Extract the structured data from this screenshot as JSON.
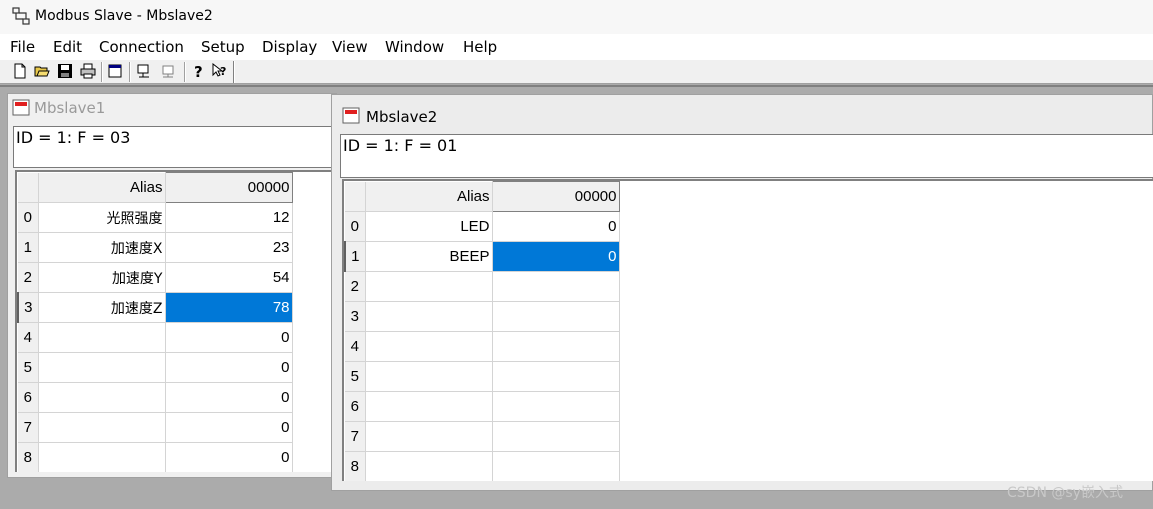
{
  "app": {
    "title": "Modbus Slave - Mbslave2"
  },
  "menu": [
    "File",
    "Edit",
    "Connection",
    "Setup",
    "Display",
    "View",
    "Window",
    "Help"
  ],
  "toolbar": {
    "buttons": [
      "new-icon",
      "open-icon",
      "save-icon",
      "print-icon",
      "window-icon",
      "connect-icon",
      "disconnect-icon",
      "help-icon",
      "context-help-icon"
    ]
  },
  "windows": [
    {
      "name": "Mbslave1",
      "info": "ID = 1: F = 03",
      "columns": {
        "alias": "Alias",
        "address": "00000"
      },
      "rows": [
        {
          "index": "0",
          "alias": "光照强度",
          "value": "12"
        },
        {
          "index": "1",
          "alias": "加速度X",
          "value": "23"
        },
        {
          "index": "2",
          "alias": "加速度Y",
          "value": "54"
        },
        {
          "index": "3",
          "alias": "加速度Z",
          "value": "78"
        },
        {
          "index": "4",
          "alias": "",
          "value": "0"
        },
        {
          "index": "5",
          "alias": "",
          "value": "0"
        },
        {
          "index": "6",
          "alias": "",
          "value": "0"
        },
        {
          "index": "7",
          "alias": "",
          "value": "0"
        },
        {
          "index": "8",
          "alias": "",
          "value": "0"
        }
      ],
      "selected_row": 3
    },
    {
      "name": "Mbslave2",
      "info": "ID = 1: F = 01",
      "columns": {
        "alias": "Alias",
        "address": "00000"
      },
      "rows": [
        {
          "index": "0",
          "alias": "LED",
          "value": "0"
        },
        {
          "index": "1",
          "alias": "BEEP",
          "value": "0"
        },
        {
          "index": "2",
          "alias": "",
          "value": ""
        },
        {
          "index": "3",
          "alias": "",
          "value": ""
        },
        {
          "index": "4",
          "alias": "",
          "value": ""
        },
        {
          "index": "5",
          "alias": "",
          "value": ""
        },
        {
          "index": "6",
          "alias": "",
          "value": ""
        },
        {
          "index": "7",
          "alias": "",
          "value": ""
        },
        {
          "index": "8",
          "alias": "",
          "value": ""
        }
      ],
      "selected_row": 1
    }
  ],
  "watermark": "CSDN @sy嵌入式",
  "colors": {
    "selection": "#0078d7",
    "mdi_background": "#ababab"
  }
}
